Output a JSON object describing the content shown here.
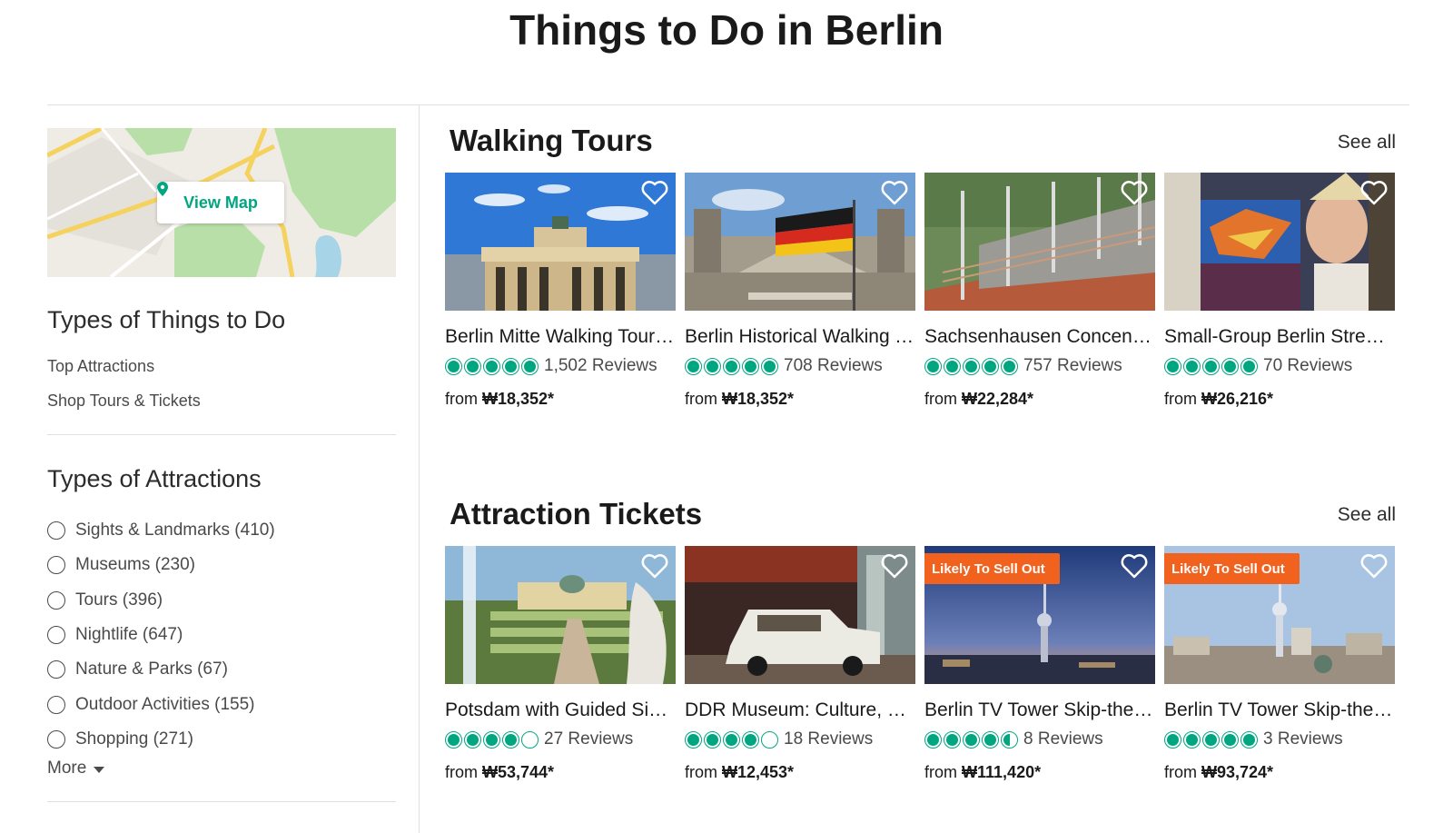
{
  "page_title": "Things to Do in Berlin",
  "sidebar": {
    "view_map_label": "View Map",
    "things_heading": "Types of Things to Do",
    "things_links": [
      "Top Attractions",
      "Shop Tours & Tickets"
    ],
    "attractions_heading": "Types of Attractions",
    "filters": [
      "Sights & Landmarks (410)",
      "Museums (230)",
      "Tours (396)",
      "Nightlife (647)",
      "Nature & Parks (67)",
      "Outdoor Activities (155)",
      "Shopping (271)"
    ],
    "more_label": "More"
  },
  "sections": [
    {
      "title": "Walking Tours",
      "see_all": "See all",
      "cards": [
        {
          "title": "Berlin Mitte Walking Tour: Brandenburg Gate",
          "reviews": "1,502 Reviews",
          "from": "from",
          "price": "₩18,352*",
          "rating": 5,
          "badge": ""
        },
        {
          "title": "Berlin Historical Walking Tour",
          "reviews": "708 Reviews",
          "from": "from",
          "price": "₩18,352*",
          "rating": 5,
          "badge": ""
        },
        {
          "title": "Sachsenhausen Concentration Camp Memorial Tour",
          "reviews": "757 Reviews",
          "from": "from",
          "price": "₩22,284*",
          "rating": 5,
          "badge": ""
        },
        {
          "title": "Small-Group Berlin Street Art Tour",
          "reviews": "70 Reviews",
          "from": "from",
          "price": "₩26,216*",
          "rating": 5,
          "badge": ""
        }
      ]
    },
    {
      "title": "Attraction Tickets",
      "see_all": "See all",
      "cards": [
        {
          "title": "Potsdam with Guided Sightseeing Tour",
          "reviews": "27 Reviews",
          "from": "from",
          "price": "₩53,744*",
          "rating": 4,
          "badge": ""
        },
        {
          "title": "DDR Museum: Culture, History, Everyday Life",
          "reviews": "18 Reviews",
          "from": "from",
          "price": "₩12,453*",
          "rating": 4,
          "badge": ""
        },
        {
          "title": "Berlin TV Tower Skip-the-Line Ticket",
          "reviews": "8 Reviews",
          "from": "from",
          "price": "₩111,420*",
          "rating": 4.5,
          "badge": "Likely To Sell Out"
        },
        {
          "title": "Berlin TV Tower Skip-the-Line Fast View",
          "reviews": "3 Reviews",
          "from": "from",
          "price": "₩93,724*",
          "rating": 5,
          "badge": "Likely To Sell Out"
        }
      ]
    }
  ],
  "colors": {
    "accent": "#00a680",
    "badge": "#f2621f",
    "text": "#1a1a1a"
  },
  "icons": [
    "map-pin-icon",
    "heart-icon",
    "chevron-down-icon",
    "rating-bubble-icon"
  ]
}
